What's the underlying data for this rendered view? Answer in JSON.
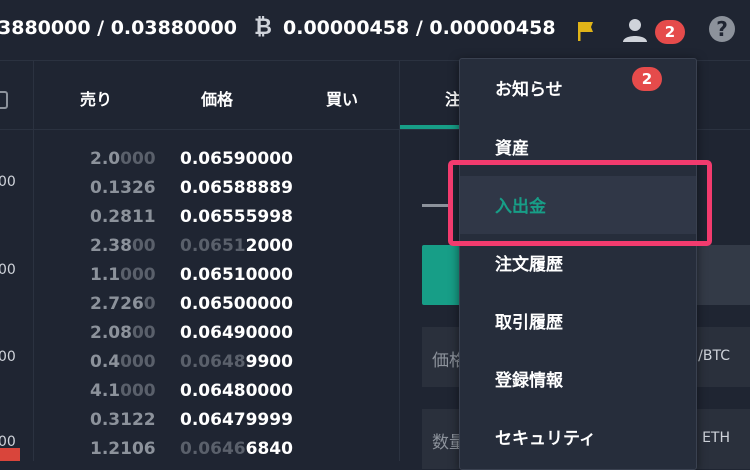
{
  "topbar": {
    "rate_left": "3880000 / 0.03880000",
    "btc_symbol": "₿",
    "rate_btc": "0.00000458 / 0.00000458",
    "notification_count": "2",
    "help_symbol": "?"
  },
  "leftcol": {
    "values": [
      "00",
      "00",
      "00",
      "00"
    ]
  },
  "orderbook": {
    "sell_header": "売り",
    "price_header": "価格",
    "buy_header": "買い",
    "rows": [
      {
        "amt_main": "2.0",
        "amt_dim": "000",
        "price_dim": "",
        "price_main": "0.06590000"
      },
      {
        "amt_main": "0.1326",
        "amt_dim": "",
        "price_dim": "",
        "price_main": "0.06588889"
      },
      {
        "amt_main": "0.2811",
        "amt_dim": "",
        "price_dim": "",
        "price_main": "0.06555998"
      },
      {
        "amt_main": "2.38",
        "amt_dim": "00",
        "price_dim": "0.0651",
        "price_main": "2000"
      },
      {
        "amt_main": "1.1",
        "amt_dim": "000",
        "price_dim": "",
        "price_main": "0.06510000"
      },
      {
        "amt_main": "2.726",
        "amt_dim": "0",
        "price_dim": "",
        "price_main": "0.06500000"
      },
      {
        "amt_main": "2.08",
        "amt_dim": "00",
        "price_dim": "",
        "price_main": "0.06490000"
      },
      {
        "amt_main": "0.4",
        "amt_dim": "000",
        "price_dim": "0.0648",
        "price_main": "9900"
      },
      {
        "amt_main": "4.1",
        "amt_dim": "000",
        "price_dim": "",
        "price_main": "0.06480000"
      },
      {
        "amt_main": "0.3122",
        "amt_dim": "",
        "price_dim": "",
        "price_main": "0.06479999"
      },
      {
        "amt_main": "1.2106",
        "amt_dim": "",
        "price_dim": "0.0646",
        "price_main": "6840"
      }
    ]
  },
  "right_panel": {
    "tab_label": "注",
    "price_field_label": "価格",
    "price_field_unit": "/BTC",
    "qty_field_label": "数量",
    "qty_field_unit": "ETH"
  },
  "menu": {
    "badge": "2",
    "items": [
      "お知らせ",
      "資産",
      "入出金",
      "注文履歴",
      "取引履歴",
      "登録情報",
      "セキュリティ"
    ]
  }
}
